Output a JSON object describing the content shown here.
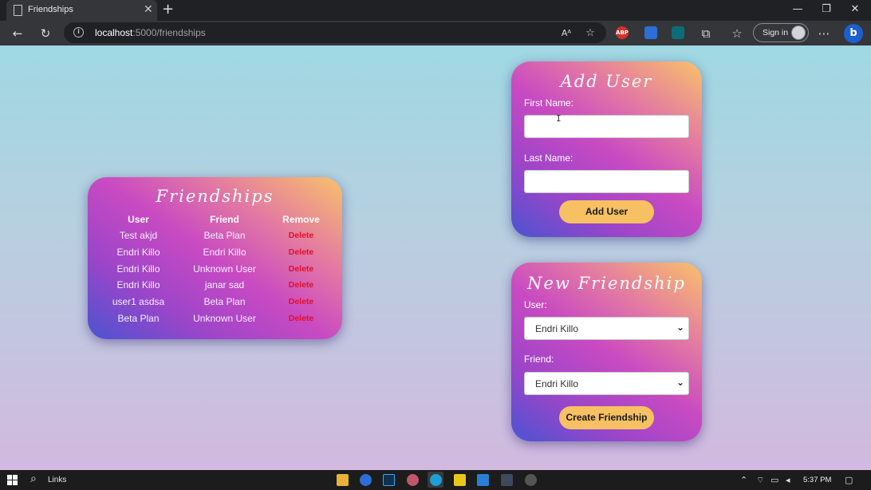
{
  "browser": {
    "tab_title": "Friendships",
    "url_host": "localhost",
    "url_rest": ":5000/friendships",
    "signin_label": "Sign in",
    "ext_abp": "ABP"
  },
  "friendships": {
    "title": "Friendships",
    "headers": [
      "User",
      "Friend",
      "Remove"
    ],
    "rows": [
      {
        "user": "Test akjd",
        "friend": "Beta Plan",
        "action": "Delete"
      },
      {
        "user": "Endri Killo",
        "friend": "Endri Killo",
        "action": "Delete"
      },
      {
        "user": "Endri Killo",
        "friend": "Unknown User",
        "action": "Delete"
      },
      {
        "user": "Endri Killo",
        "friend": "janar sad",
        "action": "Delete"
      },
      {
        "user": "user1 asdsa",
        "friend": "Beta Plan",
        "action": "Delete"
      },
      {
        "user": "Beta Plan",
        "friend": "Unknown User",
        "action": "Delete"
      }
    ]
  },
  "add_user": {
    "title": "Add User",
    "first_name_label": "First Name:",
    "first_name_value": "",
    "last_name_label": "Last Name:",
    "last_name_value": "",
    "button_label": "Add User"
  },
  "new_friendship": {
    "title": "New Friendship",
    "user_label": "User:",
    "user_selected": "Endri Killo",
    "friend_label": "Friend:",
    "friend_selected": "Endri Killo",
    "button_label": "Create Friendship"
  },
  "taskbar": {
    "links_label": "Links",
    "time": "5:37 PM"
  },
  "colors": {
    "card_gradient": [
      "#4a54d1",
      "#c94ac2",
      "#f9c16a"
    ],
    "button": "#f7c063",
    "delete": "#e0102a",
    "page_bg_top": "#9fd8e3",
    "page_bg_bottom": "#d2b9df"
  }
}
